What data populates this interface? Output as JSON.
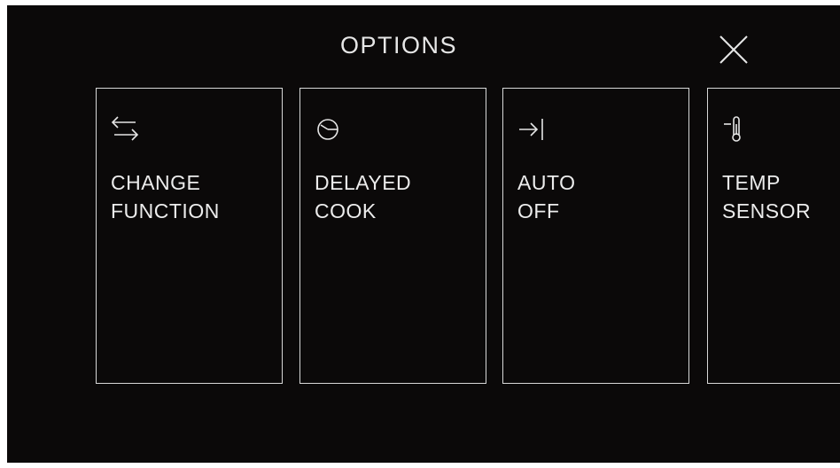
{
  "header": {
    "title": "OPTIONS",
    "close_icon": "close-icon"
  },
  "options": [
    {
      "line1": "CHANGE",
      "line2": "FUNCTION",
      "icon": "swap-arrows-icon"
    },
    {
      "line1": "DELAYED",
      "line2": "COOK",
      "icon": "clock-icon"
    },
    {
      "line1": "AUTO",
      "line2": "OFF",
      "icon": "arrow-to-bar-icon"
    },
    {
      "line1": "TEMP",
      "line2": "SENSOR",
      "icon": "thermometer-icon"
    }
  ],
  "colors": {
    "background": "#0b0909",
    "foreground": "#e9e9e9",
    "border": "#d8d8d8"
  }
}
